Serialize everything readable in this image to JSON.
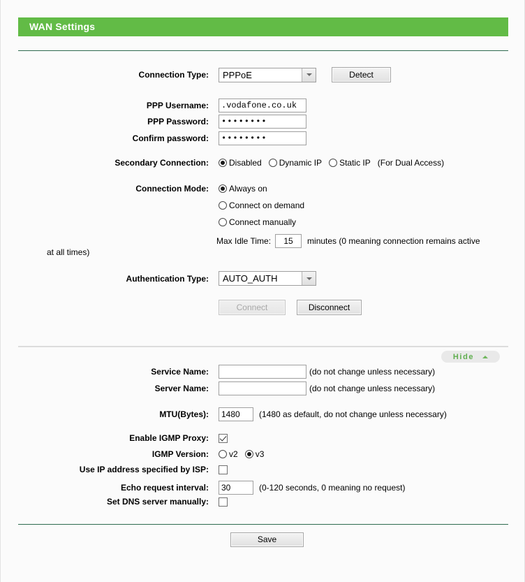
{
  "header": {
    "title": "WAN Settings"
  },
  "connection_type": {
    "label": "Connection Type:",
    "value": "PPPoE",
    "detect_button": "Detect"
  },
  "ppp": {
    "username_label": "PPP Username:",
    "username_value": ".vodafone.co.uk",
    "password_label": "PPP Password:",
    "password_value": "••••••••",
    "confirm_label": "Confirm password:",
    "confirm_value": "••••••••"
  },
  "secondary_connection": {
    "label": "Secondary Connection:",
    "options": [
      {
        "label": "Disabled",
        "selected": true
      },
      {
        "label": "Dynamic IP",
        "selected": false
      },
      {
        "label": "Static IP",
        "selected": false
      }
    ],
    "note": "(For Dual Access)"
  },
  "connection_mode": {
    "label": "Connection Mode:",
    "options": [
      {
        "label": "Always on",
        "selected": true
      },
      {
        "label": "Connect on demand",
        "selected": false
      },
      {
        "label": "Connect manually",
        "selected": false
      }
    ],
    "max_idle_label": "Max Idle Time:",
    "max_idle_value": "15",
    "max_idle_unit": "minutes (0 meaning connection remains active",
    "max_idle_wrap": "at all times)"
  },
  "auth": {
    "label": "Authentication Type:",
    "value": "AUTO_AUTH",
    "connect_button": "Connect",
    "disconnect_button": "Disconnect"
  },
  "advanced": {
    "hide_label": "Hide",
    "service_name_label": "Service Name:",
    "service_name_value": "",
    "service_name_hint": "(do not change unless necessary)",
    "server_name_label": "Server Name:",
    "server_name_value": "",
    "server_name_hint": "(do not change unless necessary)",
    "mtu_label": "MTU(Bytes):",
    "mtu_value": "1480",
    "mtu_hint": "(1480 as default, do not change unless necessary)",
    "igmp_proxy_label": "Enable IGMP Proxy:",
    "igmp_version_label": "IGMP Version:",
    "igmp_versions": [
      {
        "label": "v2",
        "selected": false
      },
      {
        "label": "v3",
        "selected": true
      }
    ],
    "use_isp_ip_label": "Use IP address specified by ISP:",
    "echo_label": "Echo request interval:",
    "echo_value": "30",
    "echo_hint": "(0-120 seconds, 0 meaning no request)",
    "set_dns_label": "Set DNS server manually:"
  },
  "footer": {
    "save_button": "Save"
  },
  "colors": {
    "header_green": "#62bb46",
    "rule_green": "#2f6b4f",
    "hide_green": "#5fae4e"
  }
}
